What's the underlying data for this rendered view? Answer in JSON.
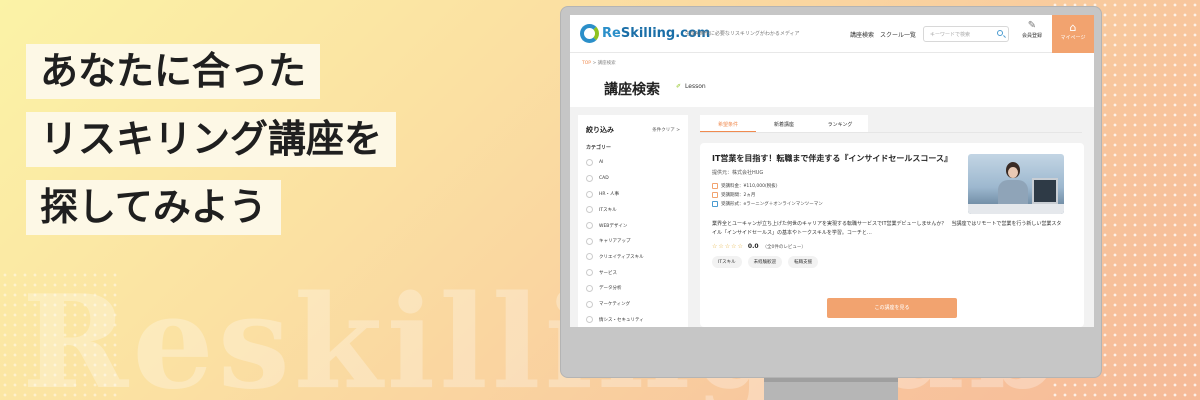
{
  "banner": {
    "headline": [
      "あなたに合った",
      "リスキリング講座を",
      "探してみよう"
    ],
    "watermark": "ReskillingLab"
  },
  "site": {
    "logo_text_re": "Re",
    "logo_text_rest": "Skilling.com",
    "tagline": "生成AI時代に必要なリスキリングがわかるメディア",
    "nav": [
      "講座検索",
      "スクール一覧"
    ],
    "search_placeholder": "キーワードで検索",
    "register_label": "会員登録",
    "mypage_label": "マイページ"
  },
  "page": {
    "breadcrumb_top": "TOP",
    "breadcrumb_current": "> 講座検索",
    "title": "講座検索",
    "subtitle": "Lesson"
  },
  "sidebar": {
    "title": "絞り込み",
    "clear": "条件クリア >",
    "category_title": "カテゴリー",
    "categories": [
      "AI",
      "CAD",
      "HR・人事",
      "ITスキル",
      "WEBデザイン",
      "キャリアアップ",
      "クリエイティブスキル",
      "サービス",
      "データ分析",
      "マーケティング",
      "情シス・セキュリティ"
    ]
  },
  "tabs": [
    "希望条件",
    "新着講座",
    "ランキング"
  ],
  "course": {
    "title": "IT営業を目指す！転職まで伴走する『インサイドセールスコース』",
    "provider": "提供元：株式会社HUG",
    "fee": "受講料金：¥110,000(税抜)",
    "period": "受講期間：2ヵ月",
    "format": "受講形式：eラーニング＋オンラインマンツーマン",
    "description": "業界全とユーキャンが立ち上げた何世のキャリアを実現する転職サービスでIT営業デビューしませんか？　当講座ではリモートで営業を行う新しい営業スタイル「インサイドセールス」の基本やトークスキルを学習。コーチと…",
    "stars": "☆☆☆☆☆",
    "rating": "0.0",
    "reviews": "（全0件のレビュー）",
    "tags": [
      "ITスキル",
      "未経験歓迎",
      "転職支援"
    ],
    "cta": "この講座を見る"
  }
}
